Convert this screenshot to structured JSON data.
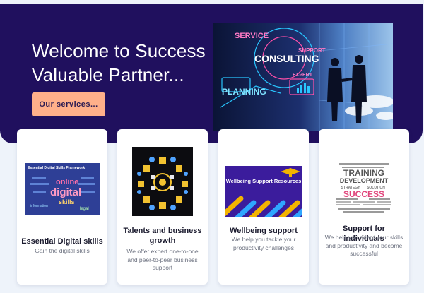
{
  "hero": {
    "title_line1": "Welcome to Success",
    "title_line2": "Valuable Partner...",
    "button_label": "Our services...",
    "image_words": [
      "SERVICE",
      "SUPPORT",
      "CONSULTING",
      "PLANNING",
      "EXPERT"
    ]
  },
  "cards": [
    {
      "title": "Essential Digital skills",
      "description": "Gain the digital skills",
      "image_caption": "Essential Digital Skills Framework",
      "image_words": [
        "online",
        "digital",
        "skills",
        "information",
        "legal"
      ]
    },
    {
      "title": "Talents and business growth",
      "description": "We offer expert one-to-one and peer-to-peer business support"
    },
    {
      "title": "Wellbeing support",
      "description": "We help you tackle your productivity challenges",
      "image_caption": "Wellbeing Support Resources"
    },
    {
      "title": "Support for individuals",
      "description": "We help you adapt your skills and productivity and become successful",
      "image_words": [
        "TRAINING",
        "DEVELOPMENT",
        "STRATEGY",
        "SOLUTION",
        "SUCCESS"
      ]
    }
  ],
  "colors": {
    "hero_background": "#20105e",
    "button_background": "#ffb08a",
    "page_background": "#eef3fa"
  }
}
